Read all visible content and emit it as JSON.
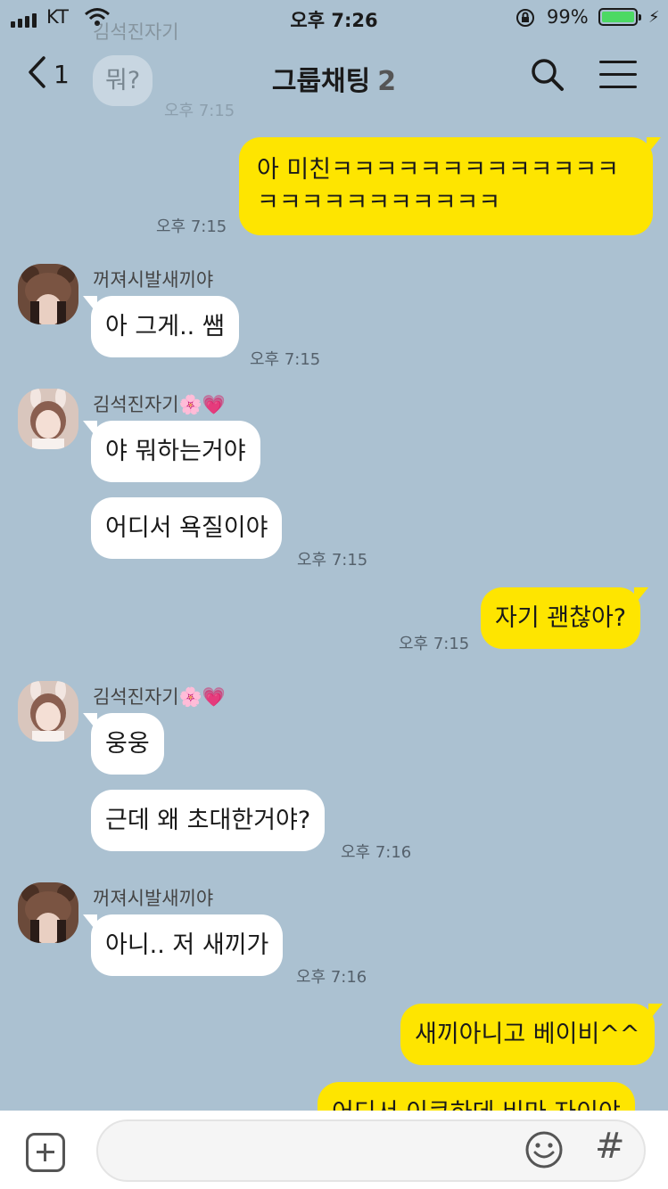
{
  "status_bar": {
    "carrier": "KT",
    "time": "오후 7:26",
    "battery_percent": "99%",
    "battery_level": 0.99
  },
  "header": {
    "back_count": "1",
    "title": "그룹채팅",
    "member_count": "2"
  },
  "ghost": {
    "sender": "김석진자기",
    "text": "뭐?",
    "time": "오후 7:15"
  },
  "messages": [
    {
      "side": "out",
      "lines": [
        "아 미친ㅋㅋㅋㅋㅋㅋㅋㅋㅋㅋㅋㅋㅋ",
        "ㅋㅋㅋㅋㅋㅋㅋㅋㅋㅋㅋ"
      ],
      "time": "오후 7:15"
    },
    {
      "side": "in",
      "sender": "꺼져시발새끼야",
      "bubbles": [
        "아 그게.. 쌤"
      ],
      "time": "오후 7:15"
    },
    {
      "side": "in",
      "sender": "김석진자기🌸💗",
      "bubbles": [
        "야 뭐하는거야",
        "어디서 욕질이야"
      ],
      "time": "오후 7:15"
    },
    {
      "side": "out",
      "text": "자기 괜찮아?",
      "time": "오후 7:15"
    },
    {
      "side": "in",
      "sender": "김석진자기🌸💗",
      "bubbles": [
        "웅웅",
        "근데 왜 초대한거야?"
      ],
      "time": "오후 7:16"
    },
    {
      "side": "in",
      "sender": "꺼져시발새끼야",
      "bubbles": [
        "아니.. 저 새끼가"
      ],
      "time": "오후 7:16"
    },
    {
      "side": "out",
      "text": "새끼아니고 베이비^^"
    },
    {
      "side": "out",
      "text": "어디서 이쿠하데 비마 자이야"
    }
  ],
  "icons": {
    "back": "chevron-left-icon",
    "search": "search-icon",
    "menu": "hamburger-menu-icon",
    "attach": "plus-box-icon",
    "emoji": "smiley-icon",
    "hashtag": "hash-icon"
  },
  "input": {
    "placeholder": "",
    "hash_symbol": "#"
  },
  "colors": {
    "background": "#abc1d1",
    "outgoing_bubble": "#fee500",
    "incoming_bubble": "#ffffff",
    "battery": "#4cd964"
  }
}
